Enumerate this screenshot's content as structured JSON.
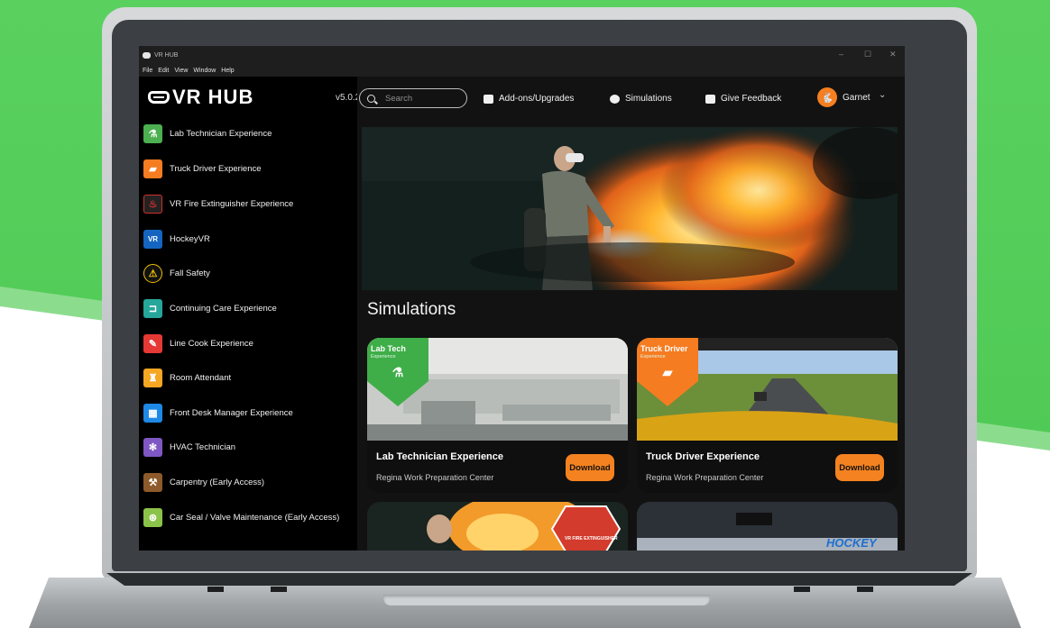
{
  "window": {
    "title": "VR HUB",
    "controls": [
      "–",
      "☐",
      "✕"
    ]
  },
  "menubar": {
    "items": [
      "File",
      "Edit",
      "View",
      "Window",
      "Help"
    ]
  },
  "sidebar": {
    "logo_text": "VR HUB",
    "version": "v5.0.2",
    "items": [
      {
        "label": "Lab Technician Experience",
        "icon": "flask-icon",
        "color": "#4caf50"
      },
      {
        "label": "Truck Driver Experience",
        "icon": "truck-icon",
        "color": "#f57c20"
      },
      {
        "label": "VR Fire Extinguisher Experience",
        "icon": "fire-extinguisher-icon",
        "color": "#d32f2f"
      },
      {
        "label": "HockeyVR",
        "icon": "hockey-icon",
        "color": "#1565c0"
      },
      {
        "label": "Fall Safety",
        "icon": "fall-safety-icon",
        "color": "#f2c200"
      },
      {
        "label": "Continuing Care Experience",
        "icon": "hospital-bed-icon",
        "color": "#26a69a"
      },
      {
        "label": "Line Cook Experience",
        "icon": "chef-knife-icon",
        "color": "#e53935"
      },
      {
        "label": "Room Attendant",
        "icon": "housekeeping-icon",
        "color": "#f5a623"
      },
      {
        "label": "Front Desk Manager Experience",
        "icon": "front-desk-icon",
        "color": "#1e88e5"
      },
      {
        "label": "HVAC Technician",
        "icon": "hvac-fan-icon",
        "color": "#7e57c2"
      },
      {
        "label": "Carpentry (Early Access)",
        "icon": "carpentry-icon",
        "color": "#8d5a2b"
      },
      {
        "label": "Car Seal / Valve Maintenance (Early Access)",
        "icon": "valve-icon",
        "color": "#8bc34a"
      }
    ]
  },
  "topbar": {
    "search_placeholder": "Search",
    "addons_label": "Add-ons/Upgrades",
    "simulations_label": "Simulations",
    "feedback_label": "Give Feedback",
    "user_name": "Garnet",
    "user_avatar_color": "#f57f20"
  },
  "main": {
    "section_title": "Simulations",
    "cards": [
      {
        "title": "Lab Technician Experience",
        "subtitle": "Regina Work Preparation Center",
        "button": "Download",
        "badge_title": "Lab Tech",
        "badge_subtitle": "Experience",
        "badge_color": "#3fae49"
      },
      {
        "title": "Truck Driver Experience",
        "subtitle": "Regina Work Preparation Center",
        "button": "Download",
        "badge_title": "Truck Driver",
        "badge_subtitle": "Experience",
        "badge_color": "#f57c20"
      }
    ],
    "partial_cards": [
      {
        "badge_text": "VR FIRE EXTINGUISHER"
      },
      {
        "badge_text": "HOCKEY"
      }
    ]
  },
  "colors": {
    "accent": "#f58220",
    "background": "#121212",
    "sidebar": "#000000",
    "backdrop_green": "#4cc751"
  }
}
